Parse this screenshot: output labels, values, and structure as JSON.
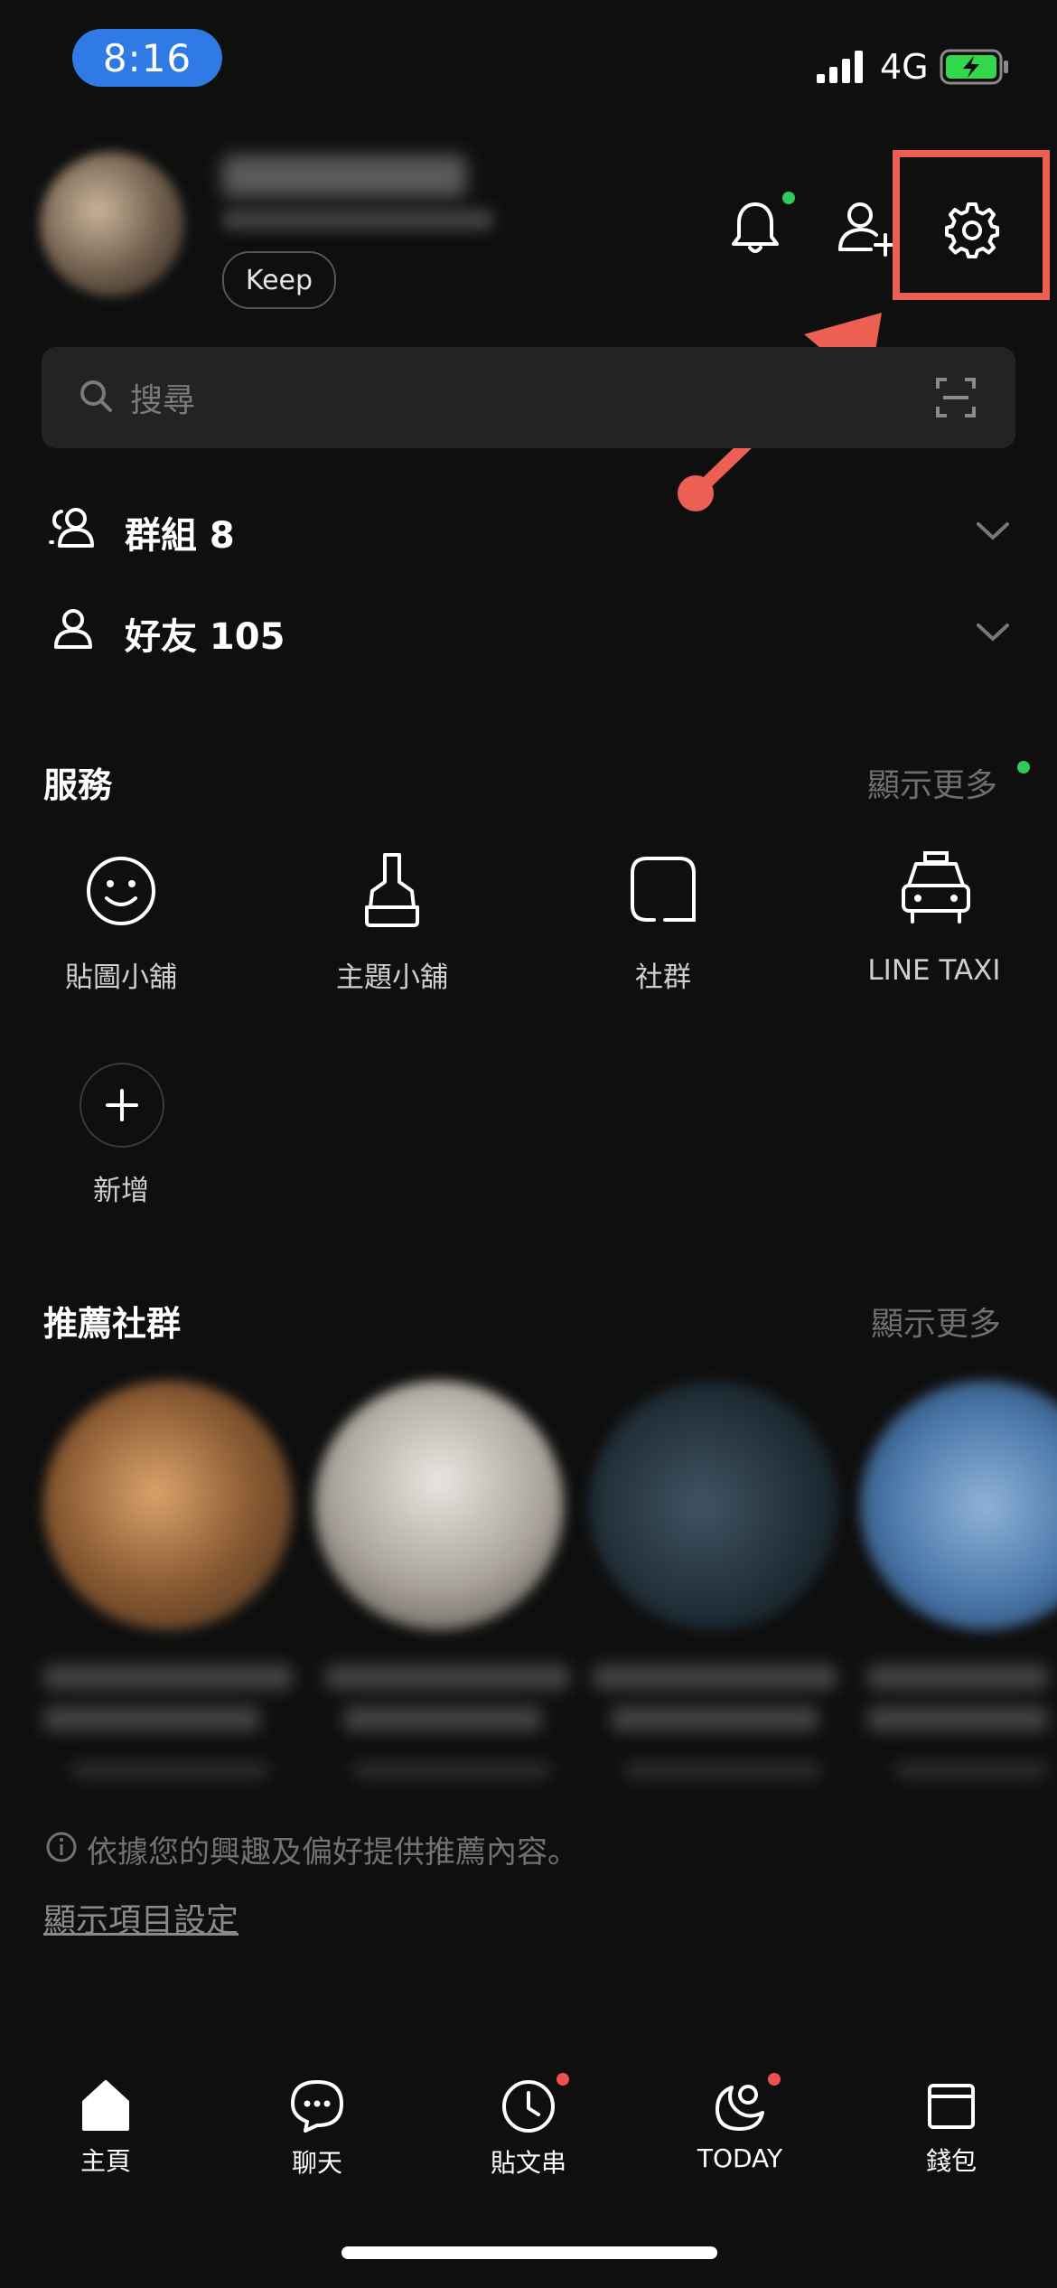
{
  "status_bar": {
    "time": "8:16",
    "network": "4G",
    "battery": "charging"
  },
  "profile": {
    "keep_label": "Keep"
  },
  "search": {
    "placeholder": "搜尋"
  },
  "lists": [
    {
      "label": "群組 8",
      "icon": "group-icon"
    },
    {
      "label": "好友 105",
      "icon": "friend-icon"
    }
  ],
  "services": {
    "title": "服務",
    "more": "顯示更多",
    "items": [
      {
        "label": "貼圖小舖",
        "icon": "smile-icon"
      },
      {
        "label": "主題小舖",
        "icon": "brush-icon"
      },
      {
        "label": "社群",
        "icon": "square-chat-icon"
      },
      {
        "label": "LINE TAXI",
        "icon": "taxi-icon"
      }
    ],
    "add_label": "新增"
  },
  "recommended": {
    "title": "推薦社群",
    "more": "顯示更多",
    "info": "依據您的興趣及偏好提供推薦內容。",
    "settings_link": "顯示項目設定"
  },
  "bottom_nav": [
    {
      "label": "主頁",
      "icon": "home-icon",
      "active": true
    },
    {
      "label": "聊天",
      "icon": "chat-icon"
    },
    {
      "label": "貼文串",
      "icon": "clock-icon",
      "badge": true
    },
    {
      "label": "TODAY",
      "icon": "today-icon",
      "badge": true
    },
    {
      "label": "錢包",
      "icon": "wallet-icon"
    }
  ],
  "colors": {
    "accent_blue": "#2f7ae5",
    "annotation_red": "#ec5f52",
    "online_green": "#2fc95e"
  }
}
